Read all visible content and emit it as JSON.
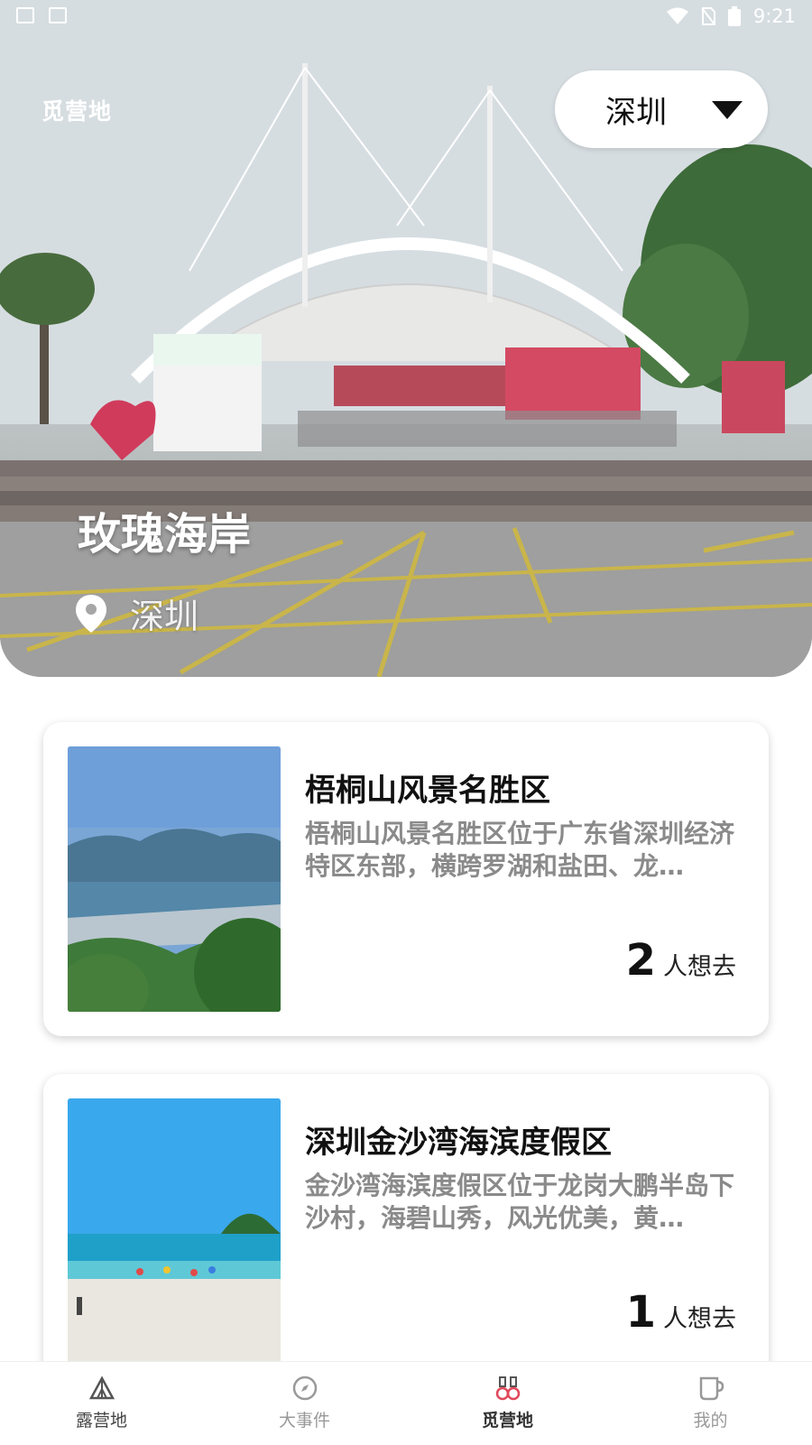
{
  "status_bar": {
    "time": "9:21"
  },
  "header": {
    "app_title": "觅营地",
    "city_select_value": "深圳"
  },
  "hero": {
    "name": "玫瑰海岸",
    "location": "深圳",
    "icons": [
      "location-pin-icon"
    ]
  },
  "cards": [
    {
      "title": "梧桐山风景名胜区",
      "desc": "梧桐山风景名胜区位于广东省深圳经济特区东部，横跨罗湖和盐田、龙…",
      "count": "2",
      "count_label": "人想去"
    },
    {
      "title": "深圳金沙湾海滨度假区",
      "desc": "金沙湾海滨度假区位于龙岗大鹏半岛下沙村，海碧山秀，风光优美，黄…",
      "count": "1",
      "count_label": "人想去"
    }
  ],
  "bottom_nav": {
    "items": [
      {
        "label": "露营地",
        "icon": "tent-icon"
      },
      {
        "label": "大事件",
        "icon": "compass-icon"
      },
      {
        "label": "觅营地",
        "icon": "binoculars-icon"
      },
      {
        "label": "我的",
        "icon": "cup-icon"
      }
    ],
    "active_index": 2
  }
}
